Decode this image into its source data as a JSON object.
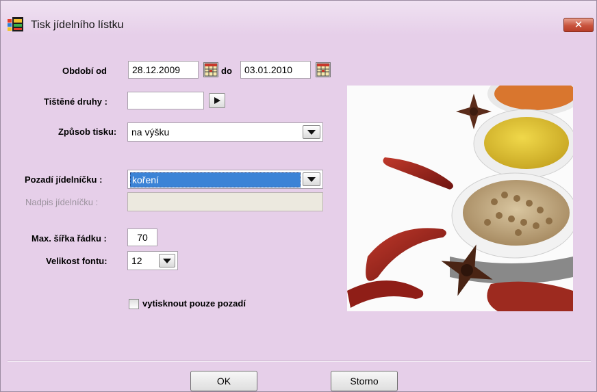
{
  "window": {
    "title": "Tisk jídelního lístku",
    "close_label": "✕"
  },
  "form": {
    "period_label": "Období od",
    "date_from": "28.12.2009",
    "to_label": "do",
    "date_to": "03.01.2010",
    "printed_types_label": "Tištěné druhy :",
    "printed_types_value": "",
    "print_mode_label": "Způsob tisku:",
    "print_mode_value": "na výšku",
    "background_label": "Pozadí jídelníčku :",
    "background_value": "koření",
    "heading_label": "Nadpis jídelníčku :",
    "heading_value": "",
    "max_width_label": "Max. šířka řádku :",
    "max_width_value": "70",
    "font_size_label": "Velikost fontu:",
    "font_size_value": "12",
    "print_background_only_label": "vytisknout pouze pozadí",
    "print_background_only_checked": false
  },
  "buttons": {
    "ok_label": "OK",
    "cancel_label": "Storno"
  },
  "colors": {
    "window_bg": "#e6cfe9",
    "selection": "#3b83d6",
    "close_red": "#c8533d"
  }
}
